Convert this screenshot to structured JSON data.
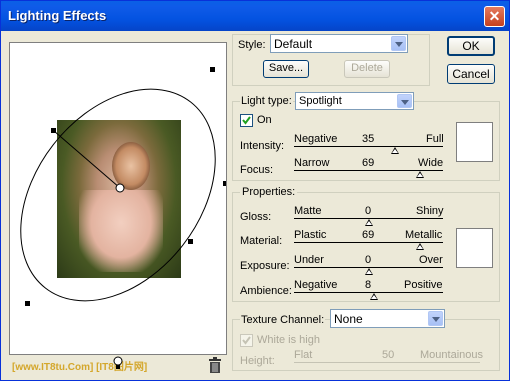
{
  "window": {
    "title": "Lighting Effects"
  },
  "buttons": {
    "ok": "OK",
    "cancel": "Cancel",
    "save": "Save...",
    "delete": "Delete"
  },
  "style_field": {
    "label": "Style:",
    "value": "Default"
  },
  "light_type": {
    "label": "Light type:",
    "value": "Spotlight",
    "on_label": "On",
    "on_checked": true,
    "intensity": {
      "label": "Intensity:",
      "left": "Negative",
      "value": "35",
      "right": "Full",
      "fraction": 0.675
    },
    "focus": {
      "label": "Focus:",
      "left": "Narrow",
      "value": "69",
      "right": "Wide",
      "fraction": 0.845
    }
  },
  "properties": {
    "legend": "Properties:",
    "gloss": {
      "label": "Gloss:",
      "left": "Matte",
      "value": "0",
      "right": "Shiny",
      "fraction": 0.5
    },
    "material": {
      "label": "Material:",
      "left": "Plastic",
      "value": "69",
      "right": "Metallic",
      "fraction": 0.845
    },
    "exposure": {
      "label": "Exposure:",
      "left": "Under",
      "value": "0",
      "right": "Over",
      "fraction": 0.5
    },
    "ambience": {
      "label": "Ambience:",
      "left": "Negative",
      "value": "8",
      "right": "Positive",
      "fraction": 0.54
    }
  },
  "texture": {
    "label": "Texture Channel:",
    "value": "None",
    "white_is_high_label": "White is high",
    "height": {
      "label": "Height:",
      "left": "Flat",
      "value": "50",
      "right": "Mountainous",
      "fraction": 0.5
    }
  },
  "watermark": "[www.IT8tu.Com] [IT8图片网]",
  "colors": {
    "titlebar": "#0453e1",
    "panel": "#ece9d8",
    "accent": "#003c74"
  },
  "icons": [
    "close-icon",
    "light-bulb-icon",
    "trash-icon",
    "chevron-down-icon",
    "checkmark-icon"
  ]
}
